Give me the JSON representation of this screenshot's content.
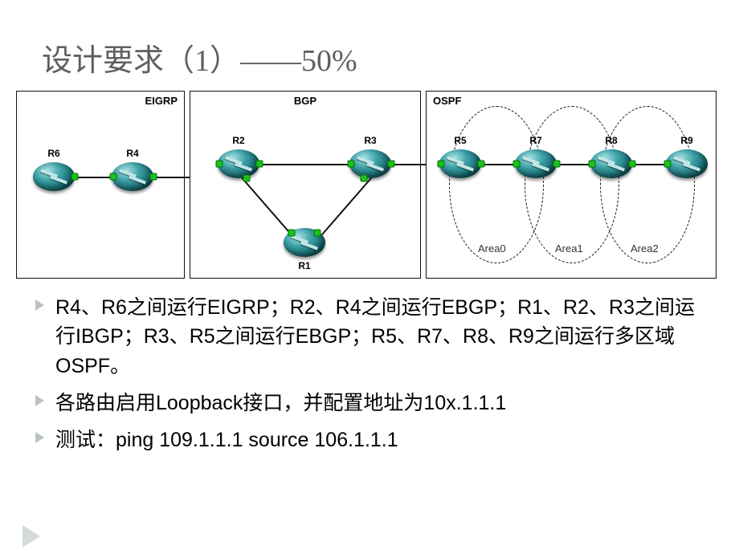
{
  "title": "设计要求（1）——50%",
  "protocols": {
    "eigrp": {
      "label": "EIGRP",
      "routers": {
        "r6": "R6",
        "r4": "R4"
      }
    },
    "bgp": {
      "label": "BGP",
      "routers": {
        "r2": "R2",
        "r3": "R3",
        "r1": "R1"
      }
    },
    "ospf": {
      "label": "OSPF",
      "routers": {
        "r5": "R5",
        "r7": "R7",
        "r8": "R8",
        "r9": "R9"
      },
      "areas": {
        "a0": "Area0",
        "a1": "Area1",
        "a2": "Area2"
      }
    }
  },
  "bullets": {
    "b1": "R4、R6之间运行EIGRP；R2、R4之间运行EBGP；R1、R2、R3之间运行IBGP；R3、R5之间运行EBGP；R5、R7、R8、R9之间运行多区域OSPF。",
    "b2": "各路由启用Loopback接口，并配置地址为10x.1.1.1",
    "b3": "测试：ping 109.1.1.1 source 106.1.1.1"
  }
}
